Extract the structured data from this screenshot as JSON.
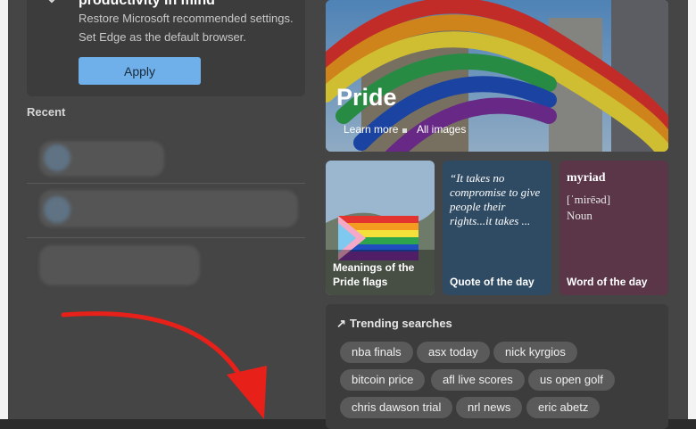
{
  "recommendation": {
    "title": "productivity in mind",
    "line1": "Restore Microsoft recommended settings.",
    "line2": "Set Edge as the default browser.",
    "apply_label": "Apply"
  },
  "recent": {
    "label": "Recent"
  },
  "hero": {
    "title": "Pride",
    "learn_more": "Learn more",
    "all_images": "All images"
  },
  "tiles": {
    "flags": {
      "label_line1": "Meanings of the",
      "label_line2": "Pride flags"
    },
    "quote": {
      "text": "“It takes no compromise to give people their rights...it takes ...",
      "label": "Quote of the day"
    },
    "word": {
      "word": "myriad",
      "phonetic": "[ˈmirēəd]",
      "pos": "Noun",
      "label": "Word of the day"
    }
  },
  "trending": {
    "heading": "Trending searches",
    "chips": [
      "nba finals",
      "asx today",
      "nick kyrgios",
      "bitcoin price",
      "afl live scores",
      "us open golf",
      "chris dawson trial",
      "nrl news",
      "eric abetz"
    ]
  },
  "colors": {
    "apply_button": "#6fb0ea",
    "annotation_arrow": "#e8201a",
    "quote_tile": "#2f4a63",
    "word_tile": "#5a3648"
  },
  "icons": [
    "settings-sliders-icon",
    "trending-arrow-icon",
    "red-annotation-arrow"
  ]
}
